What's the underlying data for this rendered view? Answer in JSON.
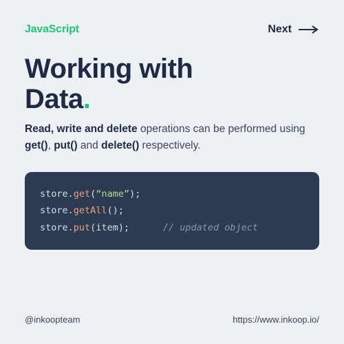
{
  "header": {
    "brand": "JavaScript",
    "next_label": "Next"
  },
  "title": {
    "line1": "Working with",
    "line2": "Data",
    "dot": "."
  },
  "description": {
    "lead_bold": "Read, write and delete",
    "seg1": " operations can be performed using ",
    "m1": "get()",
    "seg2": ", ",
    "m2": "put()",
    "seg3": " and ",
    "m3": "delete()",
    "seg4": " respectively."
  },
  "code": {
    "obj": "store",
    "dot": ".",
    "lparen": "(",
    "rparen": ")",
    "semi": ";",
    "lines": [
      {
        "method": "get",
        "argType": "string",
        "arg": "“name”",
        "comment": ""
      },
      {
        "method": "getAll",
        "argType": "none",
        "arg": "",
        "comment": ""
      },
      {
        "method": "put",
        "argType": "ident",
        "arg": "item",
        "comment": "// updated object"
      }
    ]
  },
  "footer": {
    "handle": "@inkoopteam",
    "url": "https://www.inkoop.io/"
  }
}
